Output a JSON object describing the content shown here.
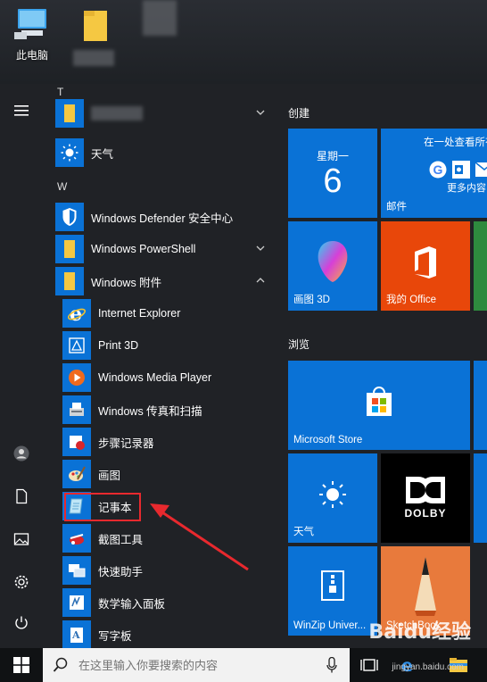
{
  "desktop": {
    "this_pc_label": "此电脑"
  },
  "start_menu": {
    "app_list": {
      "letter_t": "T",
      "letter_w": "W",
      "items": [
        {
          "label": "",
          "icon": "folder-icon",
          "expandable": true
        },
        {
          "label": "天气",
          "icon": "weather-sun-icon"
        },
        {
          "label": "Windows Defender 安全中心",
          "icon": "shield-icon"
        },
        {
          "label": "Windows PowerShell",
          "icon": "folder-icon",
          "expandable": true
        },
        {
          "label": "Windows 附件",
          "icon": "folder-icon",
          "expanded": true
        },
        {
          "label": "Internet Explorer",
          "icon": "internet-explorer-icon"
        },
        {
          "label": "Print 3D",
          "icon": "print-3d-icon"
        },
        {
          "label": "Windows Media Player",
          "icon": "media-player-icon"
        },
        {
          "label": "Windows 传真和扫描",
          "icon": "fax-scan-icon"
        },
        {
          "label": "步骤记录器",
          "icon": "steps-recorder-icon"
        },
        {
          "label": "画图",
          "icon": "paint-icon"
        },
        {
          "label": "记事本",
          "icon": "notepad-icon",
          "highlighted": true
        },
        {
          "label": "截图工具",
          "icon": "snipping-tool-icon"
        },
        {
          "label": "快速助手",
          "icon": "quick-assist-icon"
        },
        {
          "label": "数学输入面板",
          "icon": "math-input-icon"
        },
        {
          "label": "写字板",
          "icon": "wordpad-icon"
        }
      ]
    },
    "tiles": {
      "group_create": "创建",
      "group_browse": "浏览",
      "calendar_day": "星期一",
      "calendar_date": "6",
      "mail_top": "在一处查看所有",
      "mail_more": "更多内容",
      "mail_label": "邮件",
      "paint3d_label": "画图 3D",
      "office_label": "我的 Office",
      "store_label": "Microsoft Store",
      "weather_label": "天气",
      "dolby_text": "DOLBY",
      "winzip_label": "WinZip Univer...",
      "sketchbook_label": "SketchBook"
    }
  },
  "taskbar": {
    "search_placeholder": "在这里输入你要搜索的内容"
  },
  "watermark": {
    "brand": "Baidu经验",
    "url": "jingyan.baidu.com"
  },
  "colors": {
    "tile_blue": "#0a72d6",
    "office_orange": "#e8470a",
    "highlight_red": "#e8292e",
    "folder_yellow": "#f5c842"
  }
}
